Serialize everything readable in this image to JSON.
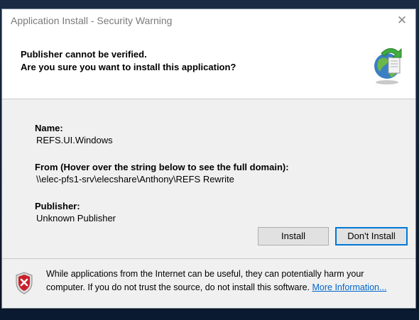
{
  "dialog": {
    "title": "Application Install - Security Warning",
    "close_glyph": "✕"
  },
  "header": {
    "line1": "Publisher cannot be verified.",
    "line2": "Are you sure you want to install this application?",
    "icon": "globe-arrow-icon"
  },
  "fields": {
    "name_label": "Name:",
    "name_value": "REFS.UI.Windows",
    "from_label": "From (Hover over the string below to see the full domain):",
    "from_value": "\\\\elec-pfs1-srv\\elecshare\\Anthony\\REFS Rewrite",
    "publisher_label": "Publisher:",
    "publisher_value": "Unknown Publisher"
  },
  "buttons": {
    "install": "Install",
    "dont_install": "Don't Install"
  },
  "footer": {
    "warning_text": "While applications from the Internet can be useful, they can potentially harm your computer. If you do not trust the source, do not install this software. ",
    "link_text": "More Information...",
    "icon": "shield-warning-icon"
  },
  "colors": {
    "link": "#0066cc",
    "focus_border": "#0078d7",
    "panel_bg": "#f0f0f0"
  }
}
